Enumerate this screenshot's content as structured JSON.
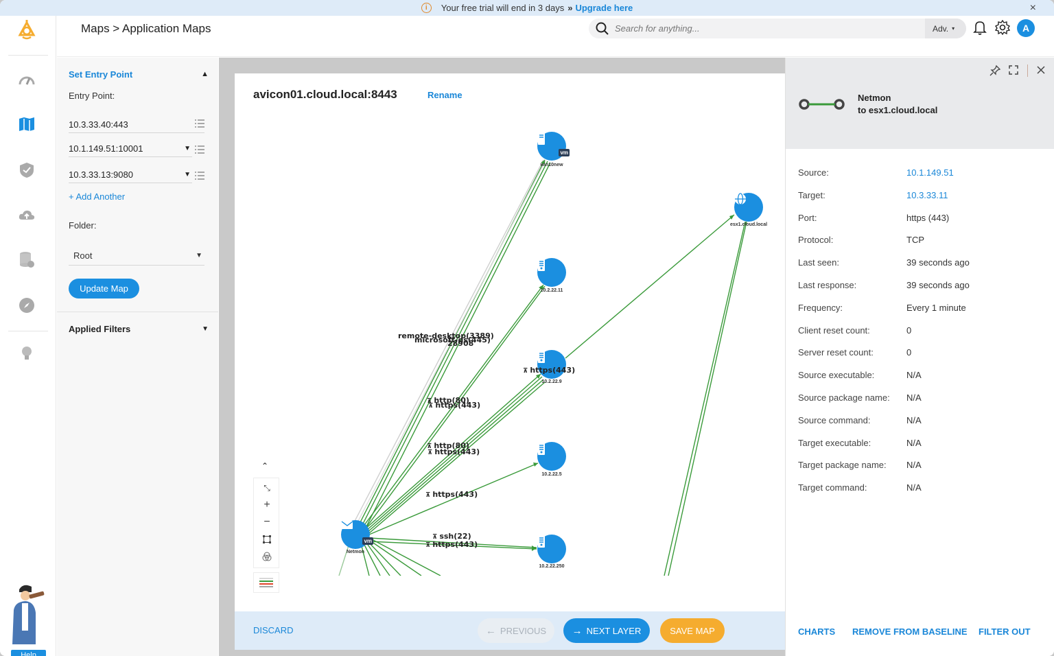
{
  "banner": {
    "message": "Your free trial will end in 3 days",
    "chevrons": "»",
    "upgrade_link": "Upgrade here",
    "close": "×"
  },
  "header": {
    "breadcrumb": "Maps > Application Maps",
    "search_placeholder": "Search for anything...",
    "adv_label": "Adv.",
    "avatar_initial": "A"
  },
  "rail": {
    "items": [
      "dashboard",
      "maps",
      "security",
      "cloud-upload",
      "database",
      "compass",
      "insights"
    ],
    "active": "maps",
    "help_label": "Help"
  },
  "config": {
    "section_title": "Set Entry Point",
    "entry_label": "Entry Point:",
    "entry_points": [
      "10.3.33.40:443",
      "10.1.149.51:10001",
      "10.3.33.13:9080"
    ],
    "add_another": "+ Add Another",
    "folder_label": "Folder:",
    "folder_value": "Root",
    "update_button": "Update Map",
    "applied_filters": "Applied Filters"
  },
  "map": {
    "title": "avicon01.cloud.local:8443",
    "rename": "Rename",
    "nodes": [
      {
        "id": "win10new",
        "label": "win10new",
        "type": "vm"
      },
      {
        "id": "n22_11",
        "label": "10.2.22.11",
        "type": "server"
      },
      {
        "id": "n22_9",
        "label": "10.2.22.9",
        "type": "server"
      },
      {
        "id": "n22_5",
        "label": "10.2.22.5",
        "type": "server"
      },
      {
        "id": "n22_250",
        "label": "10.2.22.250",
        "type": "server"
      },
      {
        "id": "esx1",
        "label": "esx1.cloud.local",
        "type": "globe"
      },
      {
        "id": "netmon",
        "label": "Netmon",
        "type": "vm-mail"
      }
    ],
    "edge_labels": [
      "remote-desktop(3389)",
      "microsoft-ds(445)",
      "28908",
      "https(443)",
      "http(80)",
      "https(443)",
      "http(80)",
      "https(443)",
      "https(443)",
      "ssh(22)",
      "https(443)"
    ],
    "zoom_tools": [
      "collapse",
      "zoom-in",
      "zoom-out",
      "fit",
      "layers"
    ],
    "legend_colors": [
      "#cccccc",
      "#3a9a3a",
      "#e0452b",
      "#888888"
    ]
  },
  "footer": {
    "discard": "DISCARD",
    "previous": "PREVIOUS",
    "next_layer": "NEXT LAYER",
    "save_map": "SAVE MAP"
  },
  "detail": {
    "title_line1": "Netmon",
    "title_line2": "to esx1.cloud.local",
    "properties": [
      {
        "key": "Source:",
        "value": "10.1.149.51",
        "link": true
      },
      {
        "key": "Target:",
        "value": "10.3.33.11",
        "link": true
      },
      {
        "key": "Port:",
        "value": "https (443)",
        "link": false
      },
      {
        "key": "Protocol:",
        "value": "TCP",
        "link": false
      },
      {
        "key": "Last seen:",
        "value": "39 seconds ago",
        "link": false
      },
      {
        "key": "Last response:",
        "value": "39 seconds ago",
        "link": false
      },
      {
        "key": "Frequency:",
        "value": "Every 1 minute",
        "link": false
      },
      {
        "key": "Client reset count:",
        "value": "0",
        "link": false
      },
      {
        "key": "Server reset count:",
        "value": "0",
        "link": false
      },
      {
        "key": "Source executable:",
        "value": "N/A",
        "link": false
      },
      {
        "key": "Source package name:",
        "value": "N/A",
        "link": false
      },
      {
        "key": "Source command:",
        "value": "N/A",
        "link": false
      },
      {
        "key": "Target executable:",
        "value": "N/A",
        "link": false
      },
      {
        "key": "Target package name:",
        "value": "N/A",
        "link": false
      },
      {
        "key": "Target command:",
        "value": "N/A",
        "link": false
      }
    ],
    "actions": [
      "CHARTS",
      "REMOVE FROM BASELINE",
      "FILTER OUT"
    ]
  },
  "colors": {
    "accent": "#1b8fe0",
    "edge": "#3a9a3a",
    "save": "#f5ac2f",
    "banner_bg": "#deebf8"
  }
}
